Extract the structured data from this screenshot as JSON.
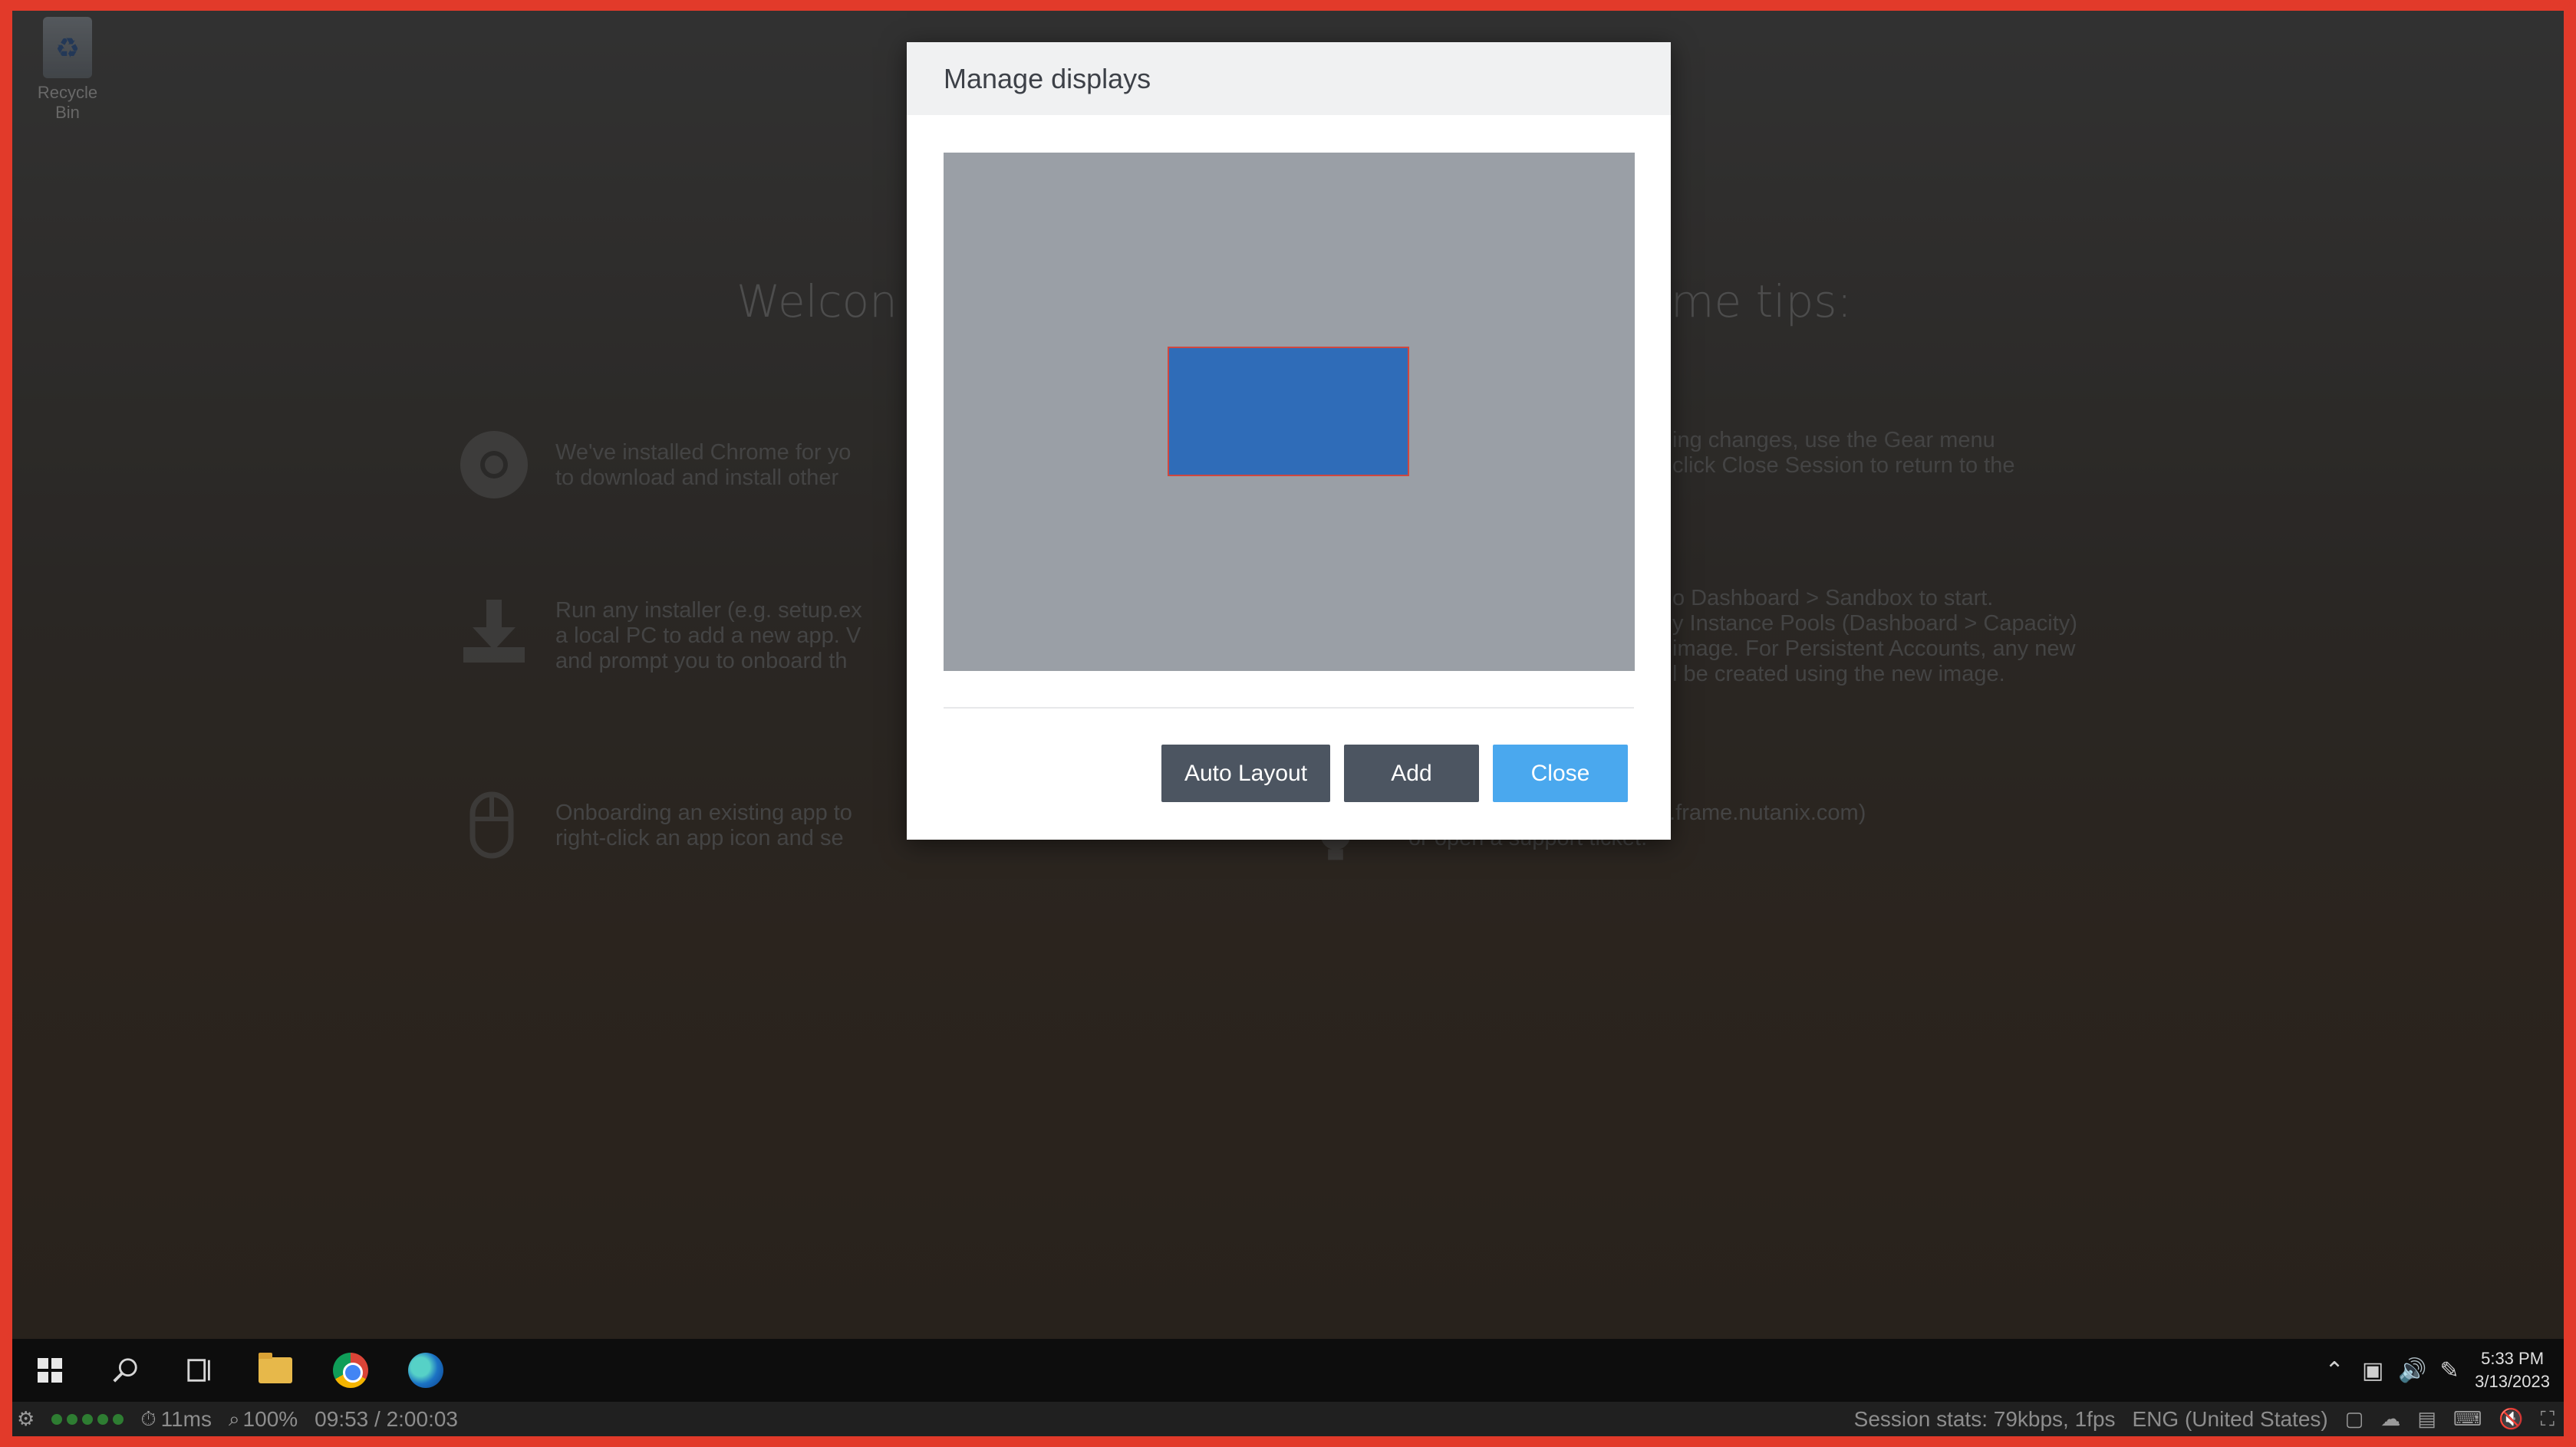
{
  "desktop": {
    "recycle_bin_label": "Recycle Bin",
    "welcome_title_left": "Welcon",
    "welcome_title_right": "me tips:",
    "tips": [
      {
        "icon": "chrome-icon",
        "lines": [
          "We've installed Chrome for yo",
          "to download and install other"
        ]
      },
      {
        "icon": "download-icon",
        "lines": [
          "Run any installer (e.g. setup.ex",
          "a local PC to add a new app. V",
          "and prompt you to onboard th"
        ]
      },
      {
        "icon": "mouse-icon",
        "lines": [
          "Onboarding an existing app to",
          "right-click an app icon and se"
        ]
      },
      {
        "icon": "gear-icon",
        "lines": [
          "ing changes, use the Gear menu",
          "click Close Session to return to the"
        ]
      },
      {
        "icon": "sandbox-icon",
        "lines": [
          "o Dashboard > Sandbox to start.",
          "y Instance Pools (Dashboard > Capacity)",
          "image. For Persistent Accounts, any new",
          "l be created using the new image."
        ]
      },
      {
        "icon": "lightbulb-icon",
        "lines": [
          "re to check our docs (docs.frame.nutanix.com)",
          "or open a support ticket."
        ]
      }
    ]
  },
  "modal": {
    "title": "Manage displays",
    "buttons": {
      "auto_layout": "Auto Layout",
      "add": "Add",
      "close": "Close"
    },
    "colors": {
      "canvas_bg": "#9a9fa6",
      "display_fill": "#2f6cb8",
      "display_border": "#d0473f",
      "primary": "#4aa8ee"
    }
  },
  "taskbar": {
    "icons": [
      "windows-start-icon",
      "search-icon",
      "task-view-icon",
      "file-explorer-icon",
      "chrome-icon",
      "edge-icon"
    ],
    "clock_time": "5:33 PM",
    "clock_date": "3/13/2023"
  },
  "statusbar": {
    "latency": "11ms",
    "zoom": "100%",
    "session_timer": "09:53 / 2:00:03",
    "session_stats": "Session stats: 79kbps, 1fps",
    "language": "ENG (United States)"
  }
}
